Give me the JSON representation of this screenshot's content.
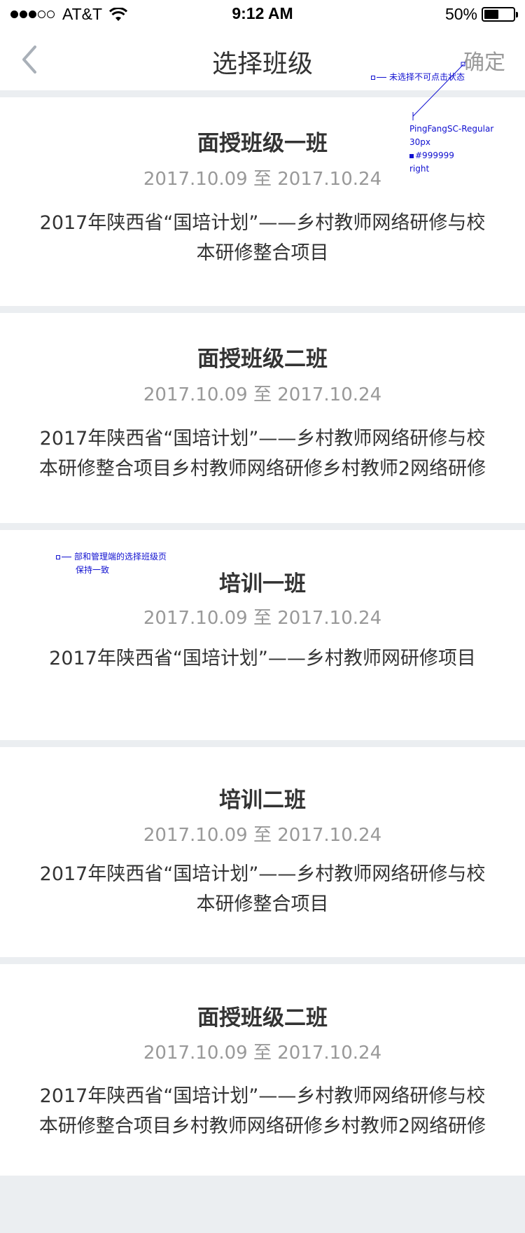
{
  "status_bar": {
    "carrier": "AT&T",
    "time": "9:12 AM",
    "battery": "50%",
    "battery_level": 0.5
  },
  "nav": {
    "title": "选择班级",
    "confirm_label": "确定"
  },
  "classes": [
    {
      "name": "面授班级一班",
      "date": "2017.10.09 至 2017.10.24",
      "description": "2017年陕西省“国培计划”——乡村教师网络研修与校本研修整合项目"
    },
    {
      "name": "面授班级二班",
      "date": "2017.10.09 至 2017.10.24",
      "description": "2017年陕西省“国培计划”——乡村教师网络研修与校本研修整合项目乡村教师网络研修乡村教师2网络研修"
    },
    {
      "name": "培训一班",
      "date": "2017.10.09 至 2017.10.24",
      "description": "2017年陕西省“国培计划”——乡村教师网研修项目"
    },
    {
      "name": "培训二班",
      "date": "2017.10.09 至 2017.10.24",
      "description": "2017年陕西省“国培计划”——乡村教师网络研修与校本研修整合项目"
    },
    {
      "name": "面授班级二班",
      "date": "2017.10.09 至 2017.10.24",
      "description": "2017年陕西省“国培计划”——乡村教师网络研修与校本研修整合项目乡村教师网络研修乡村教师2网络研修"
    }
  ],
  "annotations": {
    "confirm_state": "未选择不可点击状态",
    "font_spec": {
      "font": "PingFangSC-Regular",
      "size": "30px",
      "color": "#999999",
      "align": "right"
    },
    "consistency_note_line1": "部和管理端的选择班级页",
    "consistency_note_line2": "保持一致"
  },
  "colors": {
    "accent_annotation": "#1010d0",
    "disabled_text": "#999999",
    "background": "#ebeef1"
  }
}
